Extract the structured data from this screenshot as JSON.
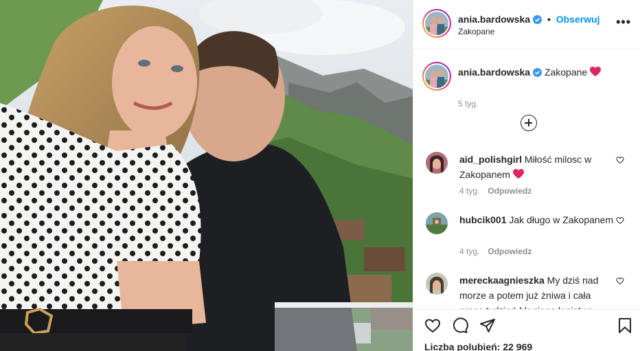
{
  "post": {
    "image_alt": "Zdjęcie: para na balkonie z widokiem na góry",
    "author": "ania.bardowska",
    "follow_label": "Obserwuj",
    "separator": "•",
    "location": "Zakopane",
    "more_label": "•••"
  },
  "caption": {
    "username": "ania.bardowska",
    "text": "Zakopane",
    "emoji": "❤️",
    "time": "5 tyg."
  },
  "comments": [
    {
      "username": "aid_polishgirl",
      "text": "Miłość milosc w Zakopanem",
      "emoji": "❤️",
      "time": "4 tyg.",
      "reply": "Odpowiedz"
    },
    {
      "username": "hubcik001",
      "text": "Jak długo w Zakopanem",
      "emoji": "",
      "time": "4 tyg.",
      "reply": "Odpowiedz"
    },
    {
      "username": "mereckaagnieszka",
      "text": "My dziś nad morze a potem już żniwa i cała praca tydzień błogiego lenistwa",
      "emoji": "",
      "time": "",
      "reply": ""
    }
  ],
  "actions": {
    "icons": [
      "heart-icon",
      "comment-icon",
      "share-icon",
      "bookmark-icon"
    ]
  },
  "likes": {
    "label": "Liczba polubień:",
    "count": "22 969"
  },
  "colors": {
    "accent": "#0095f6",
    "text": "#262626",
    "muted": "#8e8e8e",
    "emoji_heart": "#e0245e"
  }
}
